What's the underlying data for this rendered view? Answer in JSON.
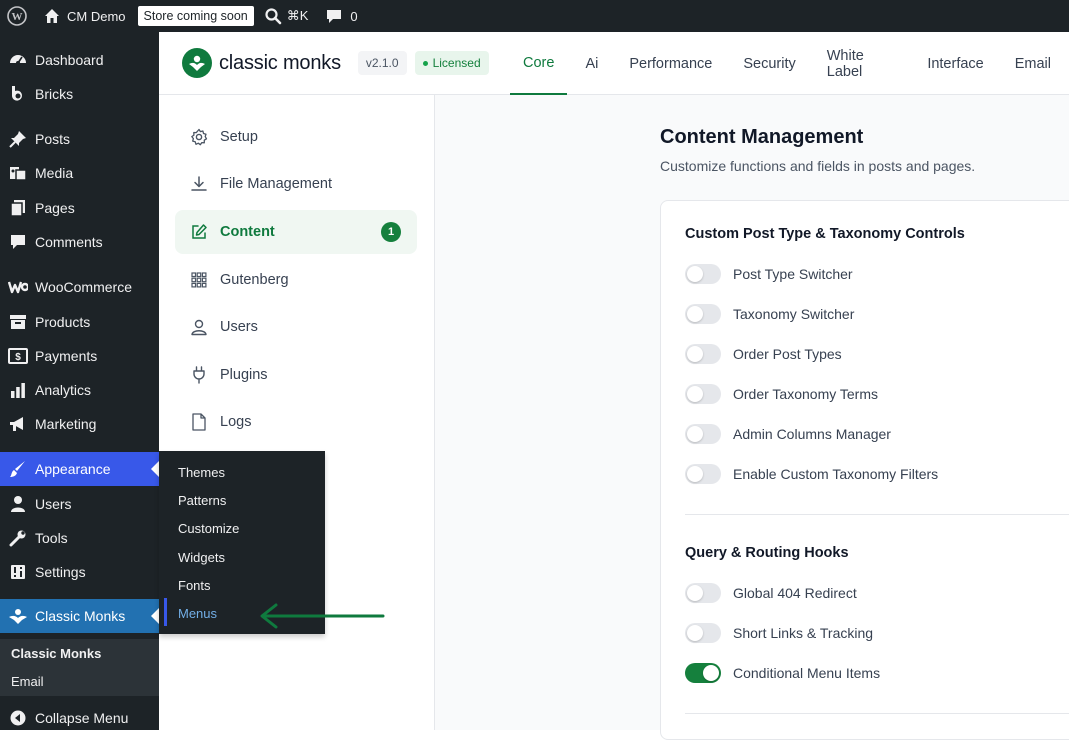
{
  "adminbar": {
    "site_name": "CM Demo",
    "store_badge": "Store coming soon",
    "search_shortcut": "⌘K",
    "comments_count": "0"
  },
  "sidebar": {
    "items": [
      {
        "label": "Dashboard",
        "icon": "dashboard-icon"
      },
      {
        "label": "Bricks",
        "icon": "bricks-icon"
      },
      {
        "label": "Posts",
        "icon": "pin-icon"
      },
      {
        "label": "Media",
        "icon": "media-icon"
      },
      {
        "label": "Pages",
        "icon": "pages-icon"
      },
      {
        "label": "Comments",
        "icon": "comments-icon"
      },
      {
        "label": "WooCommerce",
        "icon": "woocommerce-icon"
      },
      {
        "label": "Products",
        "icon": "archive-icon"
      },
      {
        "label": "Payments",
        "icon": "payments-icon"
      },
      {
        "label": "Analytics",
        "icon": "bar-chart-icon"
      },
      {
        "label": "Marketing",
        "icon": "megaphone-icon"
      },
      {
        "label": "Appearance",
        "icon": "brush-icon"
      },
      {
        "label": "Users",
        "icon": "users-icon"
      },
      {
        "label": "Tools",
        "icon": "wrench-icon"
      },
      {
        "label": "Settings",
        "icon": "settings-icon"
      },
      {
        "label": "Classic Monks",
        "icon": "classic-monks-icon"
      }
    ],
    "classic_monks_sub": [
      "Classic Monks",
      "Email"
    ],
    "collapse": "Collapse Menu"
  },
  "flyout": {
    "items": [
      "Themes",
      "Patterns",
      "Customize",
      "Widgets",
      "Fonts",
      "Menus"
    ]
  },
  "header": {
    "brand": "classic monks",
    "version": "v2.1.0",
    "license": "Licensed",
    "tabs": [
      "Core",
      "Ai",
      "Performance",
      "Security",
      "White Label",
      "Interface",
      "Email"
    ]
  },
  "leftnav": {
    "items": [
      {
        "label": "Setup",
        "icon": "gear-icon"
      },
      {
        "label": "File Management",
        "icon": "download-icon"
      },
      {
        "label": "Content",
        "icon": "edit-icon",
        "badge": "1"
      },
      {
        "label": "Gutenberg",
        "icon": "grid-icon"
      },
      {
        "label": "Users",
        "icon": "user-icon"
      },
      {
        "label": "Plugins",
        "icon": "plug-icon"
      },
      {
        "label": "Logs",
        "icon": "file-icon"
      }
    ]
  },
  "main": {
    "title": "Content Management",
    "subtitle": "Customize functions and fields in posts and pages.",
    "sections": [
      {
        "title": "Custom Post Type & Taxonomy Controls",
        "toggles": [
          {
            "label": "Post Type Switcher",
            "on": false
          },
          {
            "label": "Taxonomy Switcher",
            "on": false
          },
          {
            "label": "Order Post Types",
            "on": false
          },
          {
            "label": "Order Taxonomy Terms",
            "on": false
          },
          {
            "label": "Admin Columns Manager",
            "on": false
          },
          {
            "label": "Enable Custom Taxonomy Filters",
            "on": false
          }
        ]
      },
      {
        "title": "Query & Routing Hooks",
        "toggles": [
          {
            "label": "Global 404 Redirect",
            "on": false
          },
          {
            "label": "Short Links & Tracking",
            "on": false
          },
          {
            "label": "Conditional Menu Items",
            "on": true
          }
        ]
      }
    ]
  },
  "colors": {
    "accent": "#0f7a3e",
    "appearance_highlight": "#3858e9",
    "annotation_arrow": "#0f7a3e"
  }
}
